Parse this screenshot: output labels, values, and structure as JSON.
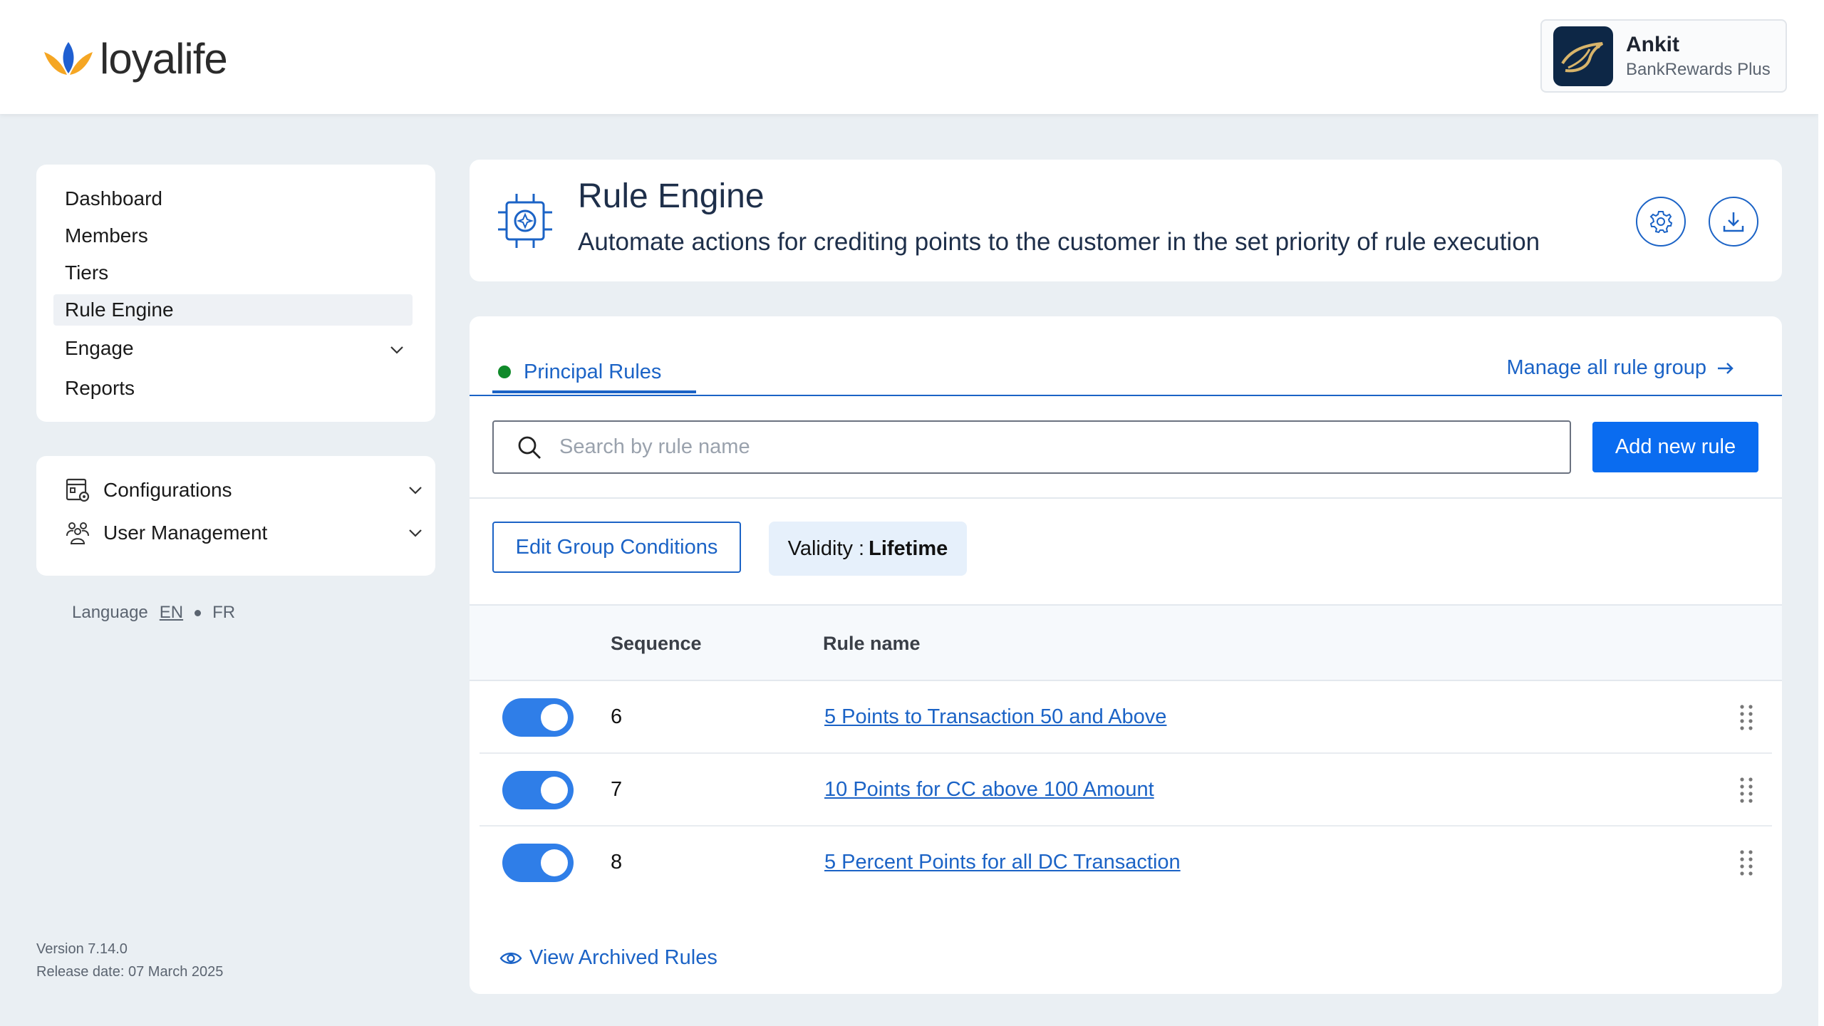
{
  "app": {
    "logo_text": "loyalife",
    "colors": {
      "primary": "#1b63c6",
      "button": "#0a6cf0",
      "toggle": "#2f7ee8",
      "status_dot": "#108a2a",
      "background": "#eaeff3"
    }
  },
  "profile": {
    "name": "Ankit",
    "org": "BankRewards Plus"
  },
  "sidebar": {
    "items": [
      {
        "label": "Dashboard"
      },
      {
        "label": "Members"
      },
      {
        "label": "Tiers"
      },
      {
        "label": "Rule Engine",
        "active": true
      },
      {
        "label": "Engage",
        "expandable": true
      },
      {
        "label": "Reports"
      }
    ],
    "config_items": [
      {
        "label": "Configurations",
        "icon": "settings-panel-icon"
      },
      {
        "label": "User Management",
        "icon": "users-icon"
      }
    ],
    "language": {
      "label": "Language",
      "options": [
        "EN",
        "FR"
      ],
      "selected": "EN"
    },
    "version": "Version 7.14.0",
    "release_date": "Release date: 07 March 2025"
  },
  "header": {
    "title": "Rule Engine",
    "subtitle": "Automate actions for crediting points to the customer in the set priority of rule execution",
    "icon": "chip-icon"
  },
  "main": {
    "tab_label": "Principal Rules",
    "manage_link": "Manage all rule group",
    "search": {
      "placeholder": "Search by rule name",
      "value": ""
    },
    "add_button": "Add new rule",
    "edit_conditions_button": "Edit Group Conditions",
    "validity": {
      "label": "Validity :",
      "value": "Lifetime"
    },
    "table": {
      "columns": [
        "Sequence",
        "Rule name"
      ],
      "rows": [
        {
          "enabled": true,
          "sequence": "6",
          "name": "5 Points to Transaction 50 and Above"
        },
        {
          "enabled": true,
          "sequence": "7",
          "name": "10 Points for CC above 100 Amount"
        },
        {
          "enabled": true,
          "sequence": "8",
          "name": "5 Percent Points for all DC Transaction"
        }
      ]
    },
    "archived_link": "View Archived Rules"
  }
}
